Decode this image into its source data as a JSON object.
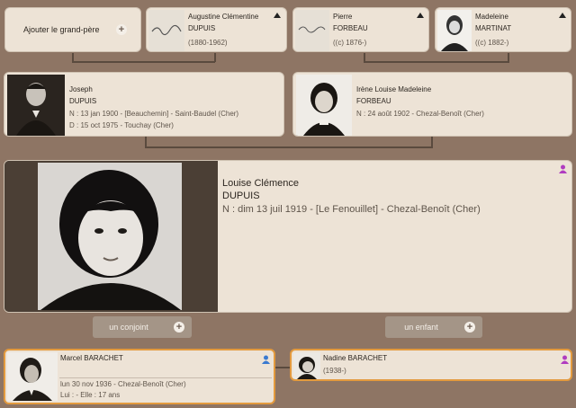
{
  "grandparents": {
    "add_grandfather": "Ajouter le grand-père",
    "augustine": {
      "first": "Augustine Clémentine",
      "last": "DUPUIS",
      "dates": "(1880-1962)"
    },
    "pierre": {
      "first": "Pierre",
      "last": "FORBEAU",
      "dates": "((c) 1876-)"
    },
    "madeleine": {
      "first": "Madeleine",
      "last": "MARTINAT",
      "dates": "((c) 1882-)"
    }
  },
  "parents": {
    "joseph": {
      "first": "Joseph",
      "last": "DUPUIS",
      "birth": "N : 13 jan 1900 - [Beauchemin] - Saint-Baudel (Cher)",
      "death": "D : 15 oct 1975 - Touchay (Cher)"
    },
    "irene": {
      "first": "Irène Louise Madeleine",
      "last": "FORBEAU",
      "birth": "N : 24 août 1902 - Chezal-Benoît (Cher)"
    }
  },
  "main": {
    "first": "Louise Clémence",
    "last": "DUPUIS",
    "birth": "N : dim 13 juil 1919 - [Le Fenouillet] - Chezal-Benoît (Cher)"
  },
  "actions": {
    "add_spouse": "un conjoint",
    "add_child": "un enfant",
    "plus": "+"
  },
  "spouse": {
    "name": "Marcel BARACHET",
    "birth": "lun 30 nov 1936 - Chezal-Benoît (Cher)",
    "ages": "Lui :  - Elle : 17 ans"
  },
  "child": {
    "name": "Nadine BARACHET",
    "dates": "(1938-)"
  },
  "colors": {
    "male": "#3a7ad0",
    "female": "#b03cc0",
    "highlight": "#e39a3e"
  }
}
